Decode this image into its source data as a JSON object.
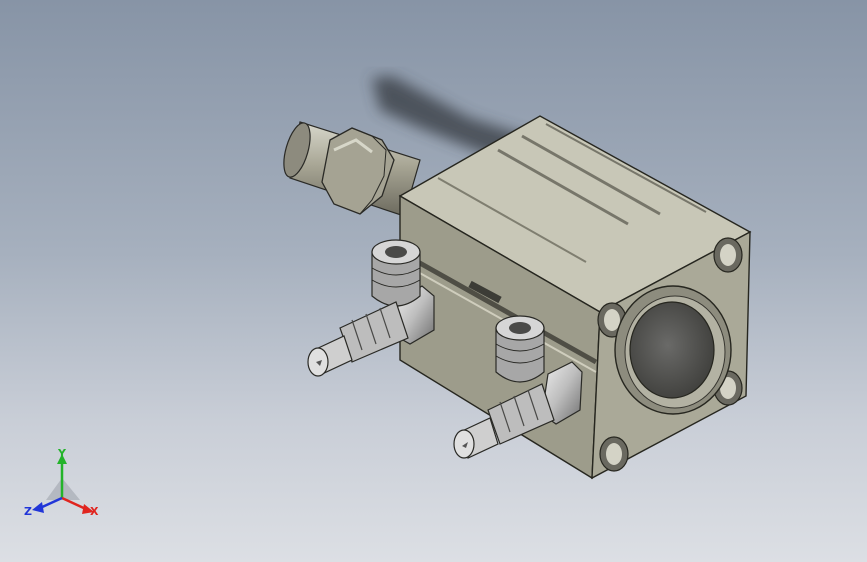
{
  "viewport": {
    "background_top": "#8794a6",
    "background_bottom": "#dcdfe4"
  },
  "model": {
    "name": "compact-pneumatic-cylinder",
    "body_color": "#a09f8e",
    "fitting_color": "#c7c7c7"
  },
  "triad": {
    "x_label": "X",
    "y_label": "Y",
    "z_label": "Z",
    "x_color": "#e0251f",
    "y_color": "#23b32a",
    "z_color": "#2136d8"
  }
}
